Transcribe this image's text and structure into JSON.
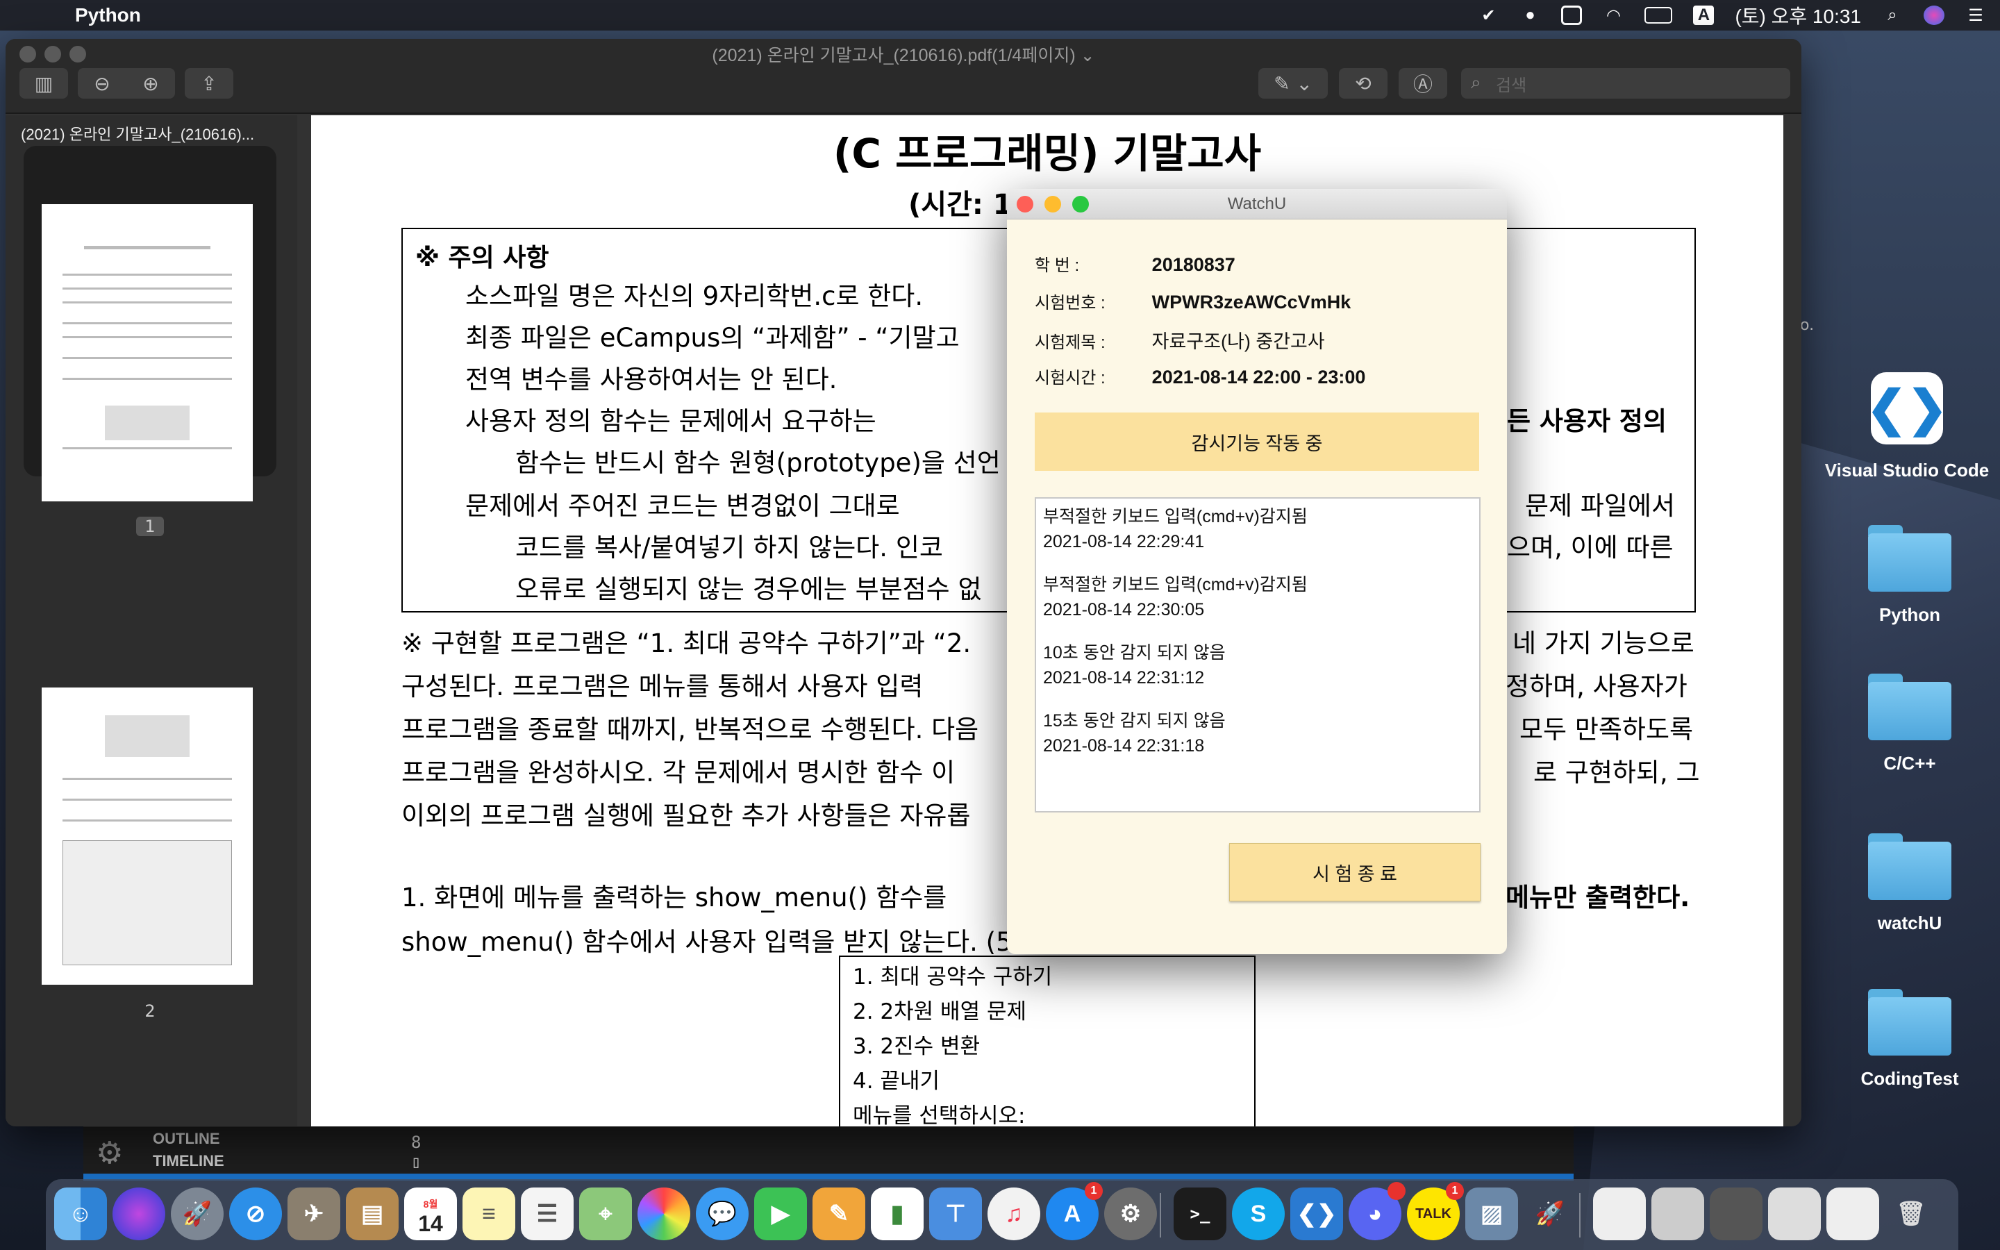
{
  "menubar": {
    "apple": "",
    "app_name": "Python",
    "clock": "(토) 오후 10:31",
    "input_source": "A",
    "icons": [
      "check-icon",
      "notification-icon",
      "window-icon",
      "wifi-icon",
      "battery-icon",
      "input-source-icon",
      "search-icon",
      "siri-icon",
      "control-center-icon"
    ]
  },
  "desktop": {
    "stray_text": "o.",
    "icons": [
      {
        "label": "Visual Studio Code",
        "kind": "vscode-app"
      },
      {
        "label": "Python",
        "kind": "folder"
      },
      {
        "label": "C/C++",
        "kind": "folder"
      },
      {
        "label": "watchU",
        "kind": "folder"
      },
      {
        "label": "CodingTest",
        "kind": "folder"
      }
    ]
  },
  "preview": {
    "title": "(2021) 온라인 기말고사_(210616).pdf(1/4페이지) ⌄",
    "search_placeholder": "검색",
    "sidebar_title": "(2021) 온라인 기말고사_(210616)...",
    "pages": [
      "1",
      "2"
    ],
    "doc": {
      "title": "(C 프로그래밍) 기말고사",
      "subtitle": "(시간: 1",
      "notice_title": "※ 주의 사항",
      "bullets": [
        "소스파일 명은 자신의 9자리학번.c로 한다.",
        "최종 파일은 eCampus의 “과제함” - “기말고",
        "전역 변수를 사용하여서는 안 된다.",
        "사용자 정의 함수는 문제에서 요구하는 ",
        "함수는 반드시 함수 원형(prototype)을 선언",
        "문제에서 주어진 코드는 변경없이 그대로 ",
        "코드를 복사/붙여넣기 하지 않는다. 인코",
        "오류로 실행되지 않는 경우에는 부분점수 없"
      ],
      "right_fragments": [
        "든 사용자 정의",
        "문제 파일에서",
        "으며, 이에 따른"
      ],
      "para1": [
        "※ 구현할 프로그램은 “1. 최대 공약수 구하기”과 “2.",
        "구성된다. 프로그램은 메뉴를 통해서 사용자 입력",
        "프로그램을 종료할 때까지, 반복적으로 수행된다. 다음",
        "프로그램을 완성하시오. 각 문제에서 명시한 함수 이",
        "이외의 프로그램 실행에 필요한 추가 사항들은 자유롭"
      ],
      "para1_right": [
        "네 가지 기능으로",
        "정하며, 사용자가",
        "모두 만족하도록",
        "로 구현하되, 그"
      ],
      "item1": "1. 화면에 메뉴를 출력하는 show_menu() 함수를 ",
      "item1_right": "메뉴만 출력한다.",
      "item1_cont": "show_menu() 함수에서 사용자 입력을 받지 않는다. (5",
      "menu_lines": [
        "1. 최대 공약수 구하기",
        "2. 2차원 배열 문제",
        "3. 2진수 변환",
        "4. 끝내기",
        "메뉴를 선택하시오:"
      ]
    }
  },
  "vscode": {
    "outline": "OUTLINE",
    "timeline": "TIMELINE",
    "terminal_lines": [
      "8",
      "▯"
    ]
  },
  "watchu": {
    "title": "WatchU",
    "fields": [
      {
        "label": "학     번 :",
        "value": "20180837",
        "bold": true
      },
      {
        "label": "시험번호 :",
        "value": "WPWR3zeAWCcVmHk",
        "bold": true
      },
      {
        "label": "시험제목 :",
        "value": "자료구조(나) 중간고사",
        "bold": false
      },
      {
        "label": "시험시간 :",
        "value": "2021-08-14 22:00 - 23:00",
        "bold": true
      }
    ],
    "monitor_status": "감시기능 작동 중",
    "logs": [
      {
        "message": "부적절한 키보드 입력(cmd+v)감지됨",
        "time": "2021-08-14 22:29:41"
      },
      {
        "message": "부적절한 키보드 입력(cmd+v)감지됨",
        "time": "2021-08-14 22:30:05"
      },
      {
        "message": "10초 동안 감지 되지 않음",
        "time": "2021-08-14 22:31:12"
      },
      {
        "message": "15초 동안 감지 되지 않음",
        "time": "2021-08-14 22:31:18"
      }
    ],
    "end_button": "시 험 종 료"
  },
  "dock": {
    "calendar_month": "8월",
    "calendar_day": "14",
    "kakao": "TALK",
    "badge": "1"
  },
  "colors": {
    "accent_yellow": "#fbe19e",
    "window_bg": "#fdf8e6",
    "traffic_red": "#fe5f57",
    "traffic_yellow": "#febc2e",
    "traffic_green": "#28c840"
  }
}
